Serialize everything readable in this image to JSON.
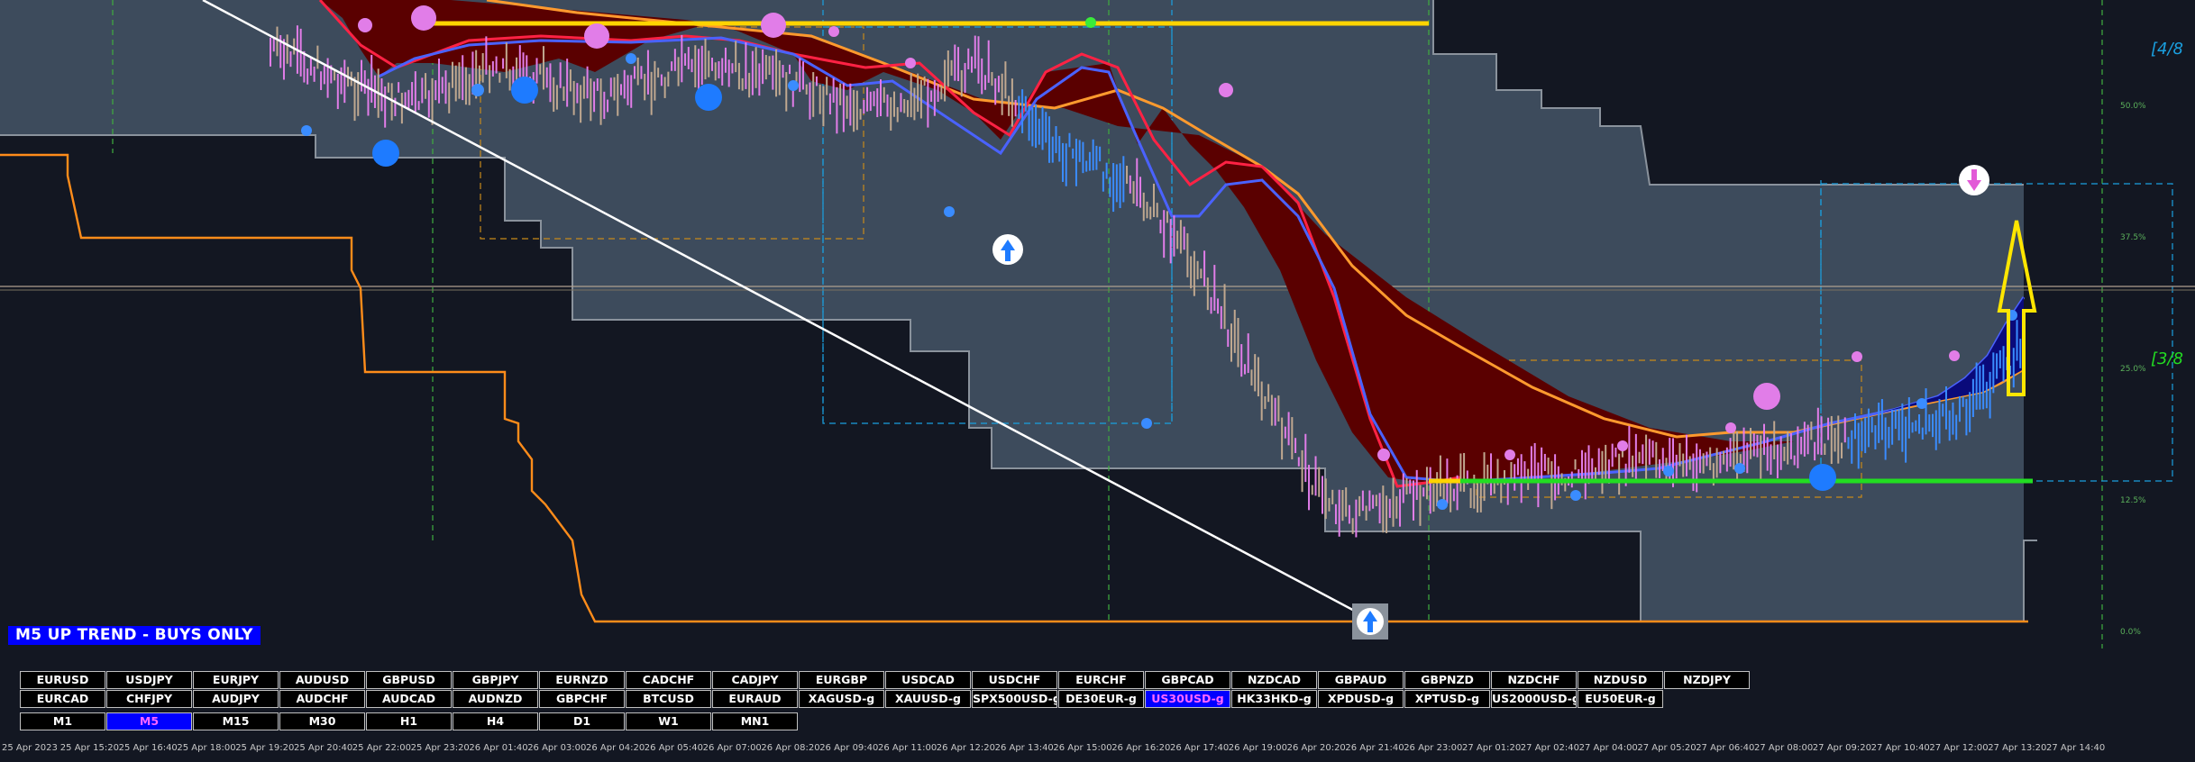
{
  "banner": {
    "text": "M5 UP TREND - BUYS ONLY"
  },
  "symbols_row1": [
    "EURUSD",
    "USDJPY",
    "EURJPY",
    "AUDUSD",
    "GBPUSD",
    "GBPJPY",
    "EURNZD",
    "CADCHF",
    "CADJPY",
    "EURGBP",
    "USDCAD",
    "USDCHF",
    "EURCHF",
    "GBPCAD",
    "NZDCAD",
    "GBPAUD",
    "GBPNZD",
    "NZDCHF",
    "NZDUSD",
    "NZDJPY"
  ],
  "symbols_row2": [
    "EURCAD",
    "CHFJPY",
    "AUDJPY",
    "AUDCHF",
    "AUDCAD",
    "AUDNZD",
    "GBPCHF",
    "BTCUSD",
    "EURAUD",
    "XAGUSD-g",
    "XAUUSD-g",
    "SPX500USD-g",
    "DE30EUR-g",
    "US30USD-g",
    "HK33HKD-g",
    "XPDUSD-g",
    "XPTUSD-g",
    "US2000USD-g",
    "EU50EUR-g"
  ],
  "active_symbol": "US30USD-g",
  "timeframes": [
    "M1",
    "M5",
    "M15",
    "M30",
    "H1",
    "H4",
    "D1",
    "W1",
    "MN1"
  ],
  "active_timeframe": "M5",
  "murrey_labels": {
    "top": "[4/8",
    "mid": "[3/8"
  },
  "colors": {
    "bg": "#131722",
    "cloud": "#3d4b5c",
    "cloud_edge": "#8a929c",
    "bear_fill": "#5a0000",
    "fast_ma": "#ff2244",
    "slow_ma": "#ff9a2e",
    "signal_line": "#4a62ff",
    "bull_candle": "#3a8cff",
    "bear_candle": "#e17de8",
    "support": "#22dd22",
    "resistance": "#ffd400",
    "channel": "#ff8c1a",
    "trendline": "#ffffff",
    "banner": "#0000ff"
  },
  "chart_data": {
    "type": "line",
    "title": "",
    "xlabel": "",
    "ylabel": "",
    "x_ticks": [
      "25 Apr 2023",
      "25 Apr 15:20",
      "25 Apr 16:40",
      "25 Apr 18:00",
      "25 Apr 19:20",
      "25 Apr 20:40",
      "25 Apr 22:00",
      "25 Apr 23:20",
      "26 Apr 01:40",
      "26 Apr 03:00",
      "26 Apr 04:20",
      "26 Apr 05:40",
      "26 Apr 07:00",
      "26 Apr 08:20",
      "26 Apr 09:40",
      "26 Apr 11:00",
      "26 Apr 12:20",
      "26 Apr 13:40",
      "26 Apr 15:00",
      "26 Apr 16:20",
      "26 Apr 17:40",
      "26 Apr 19:00",
      "26 Apr 20:20",
      "26 Apr 21:40",
      "26 Apr 23:00",
      "27 Apr 01:20",
      "27 Apr 02:40",
      "27 Apr 04:00",
      "27 Apr 05:20",
      "27 Apr 06:40",
      "27 Apr 08:00",
      "27 Apr 09:20",
      "27 Apr 10:40",
      "27 Apr 12:00",
      "27 Apr 13:20",
      "27 Apr 14:40"
    ],
    "y_range": [
      0,
      1
    ],
    "grid": false,
    "legend": "none",
    "series": [
      {
        "values": [
          0.95,
          0.93,
          0.9,
          0.88,
          0.87,
          0.9,
          0.93,
          0.91,
          0.89,
          0.88,
          0.9,
          0.92,
          0.93,
          0.91,
          0.9,
          0.88,
          0.86,
          0.87,
          0.9,
          0.93,
          0.87,
          0.8,
          0.78,
          0.74,
          0.68,
          0.6,
          0.49,
          0.38,
          0.28,
          0.23,
          0.25,
          0.27,
          0.28,
          0.28,
          0.3,
          0.3,
          0.31,
          0.32,
          0.31,
          0.32,
          0.33,
          0.34,
          0.35,
          0.36,
          0.37,
          0.38,
          0.43,
          0.5
        ]
      },
      {
        "values": [
          0.96,
          0.96,
          0.95,
          0.94,
          0.93,
          0.93,
          0.93,
          0.93,
          0.92,
          0.92,
          0.91,
          0.91,
          0.91,
          0.9,
          0.89,
          0.89,
          0.88,
          0.87,
          0.86,
          0.86,
          0.84,
          0.82,
          0.8,
          0.78,
          0.75,
          0.71,
          0.66,
          0.6,
          0.54,
          0.49,
          0.45,
          0.42,
          0.39,
          0.37,
          0.35,
          0.34,
          0.33,
          0.32,
          0.31,
          0.31,
          0.31,
          0.31,
          0.32,
          0.32,
          0.33,
          0.34,
          0.35,
          0.38
        ]
      },
      {
        "values": [
          0.8,
          0.8,
          0.8,
          0.76,
          0.76,
          0.76,
          0.72,
          0.72,
          0.72,
          0.72,
          0.66,
          0.66,
          0.6,
          0.6,
          0.55,
          0.55,
          0.5,
          0.5,
          0.45,
          0.45,
          0.4,
          0.4,
          0.36,
          0.36,
          0.3,
          0.3,
          0.18,
          0.18,
          0.18,
          0.18,
          0.18,
          0.18,
          0.18,
          0.18,
          0.18,
          0.18,
          0.18,
          0.18,
          0.18,
          0.18,
          0.18,
          0.18,
          0.18,
          0.18,
          0.18,
          0.18,
          0.18,
          0.18
        ]
      }
    ],
    "levels": {
      "resistance": 0.97,
      "support": 0.3
    }
  }
}
